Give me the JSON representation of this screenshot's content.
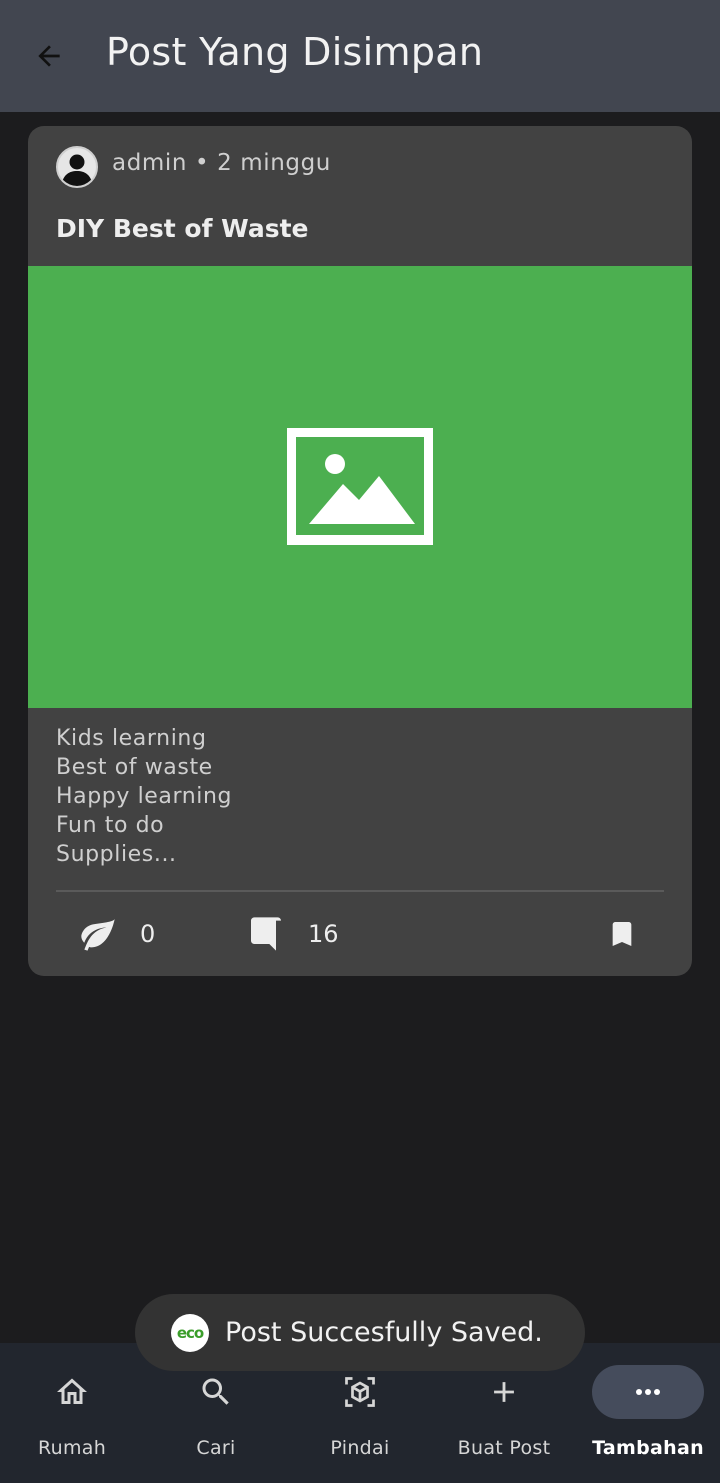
{
  "header": {
    "title": "Post Yang Disimpan",
    "back_icon": "arrow-back-icon"
  },
  "post": {
    "author": "admin",
    "separator": "•",
    "time": "2 minggu",
    "title": "DIY Best of Waste",
    "image_icon": "image-placeholder-icon",
    "image_bg": "#4caf50",
    "description_lines": [
      "Kids learning",
      "Best of waste",
      "Happy learning",
      "Fun to do",
      "Supplies..."
    ],
    "likes": "0",
    "comments": "16",
    "bookmarked": true
  },
  "toast": {
    "text": "Post Succesfully Saved.",
    "logo_text": "eco"
  },
  "bottom_nav": {
    "items": [
      {
        "label": "Rumah",
        "icon": "home-icon"
      },
      {
        "label": "Cari",
        "icon": "search-icon"
      },
      {
        "label": "Pindai",
        "icon": "scan-icon"
      },
      {
        "label": "Buat Post",
        "icon": "plus-icon"
      },
      {
        "label": "Tambahan",
        "icon": "more-icon",
        "active": true
      }
    ]
  },
  "colors": {
    "appbar": "#424650",
    "card": "#424242",
    "background": "#1c1c1e",
    "nav": "#22262e",
    "accent": "#4caf50"
  }
}
